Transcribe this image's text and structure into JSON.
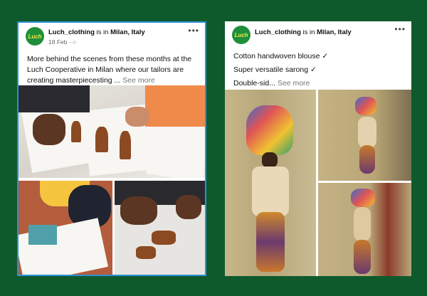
{
  "colors": {
    "background": "#0f5a2c",
    "card": "#ffffff",
    "left_border": "#2f8fd6",
    "avatar": "#1f8f3a",
    "avatar_text": "#f3e84b"
  },
  "posts": [
    {
      "avatar_text": "Luch",
      "account": "Luch_clothing",
      "connector": " is in ",
      "location": "Milan, Italy",
      "date": "18 Feb",
      "privacy_icon": "globe-icon",
      "more_icon": "more-dots-icon",
      "caption": "More behind the scenes from these months at the Luch Cooperative in Milan where our tailors are creating masterpiecesting ...",
      "see_more": "See more"
    },
    {
      "avatar_text": "Luch",
      "account": "Luch_clothing",
      "connector": " is in ",
      "location": "Milan, Italy",
      "more_icon": "more-dots-icon",
      "lines": [
        "Cotton handwoven blouse ✓",
        "Super versatile sarong ✓",
        "Double-sid..."
      ],
      "see_more": "See more"
    }
  ]
}
